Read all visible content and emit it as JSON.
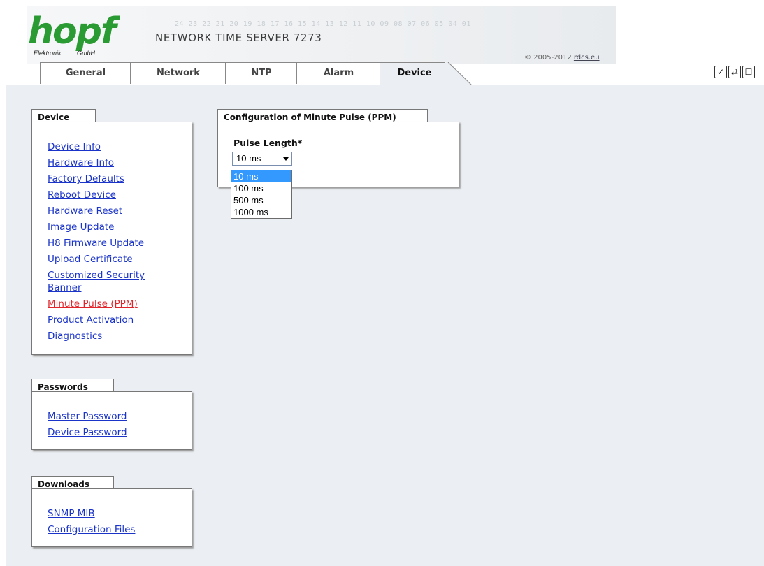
{
  "header": {
    "banner_digits": "24 23 22 21 20 19 18 17 16 15 14 13 12 11 10 09 08 07 06 05 04 01",
    "logo_text": "hopf",
    "logo_sub_left": "Elektronik",
    "logo_sub_right": "GmbH",
    "product_title": "NETWORK TIME SERVER 7273",
    "copyright_prefix": "© 2005-2012",
    "copyright_link": "rdcs.eu"
  },
  "tabs": [
    {
      "label": "General"
    },
    {
      "label": "Network"
    },
    {
      "label": "NTP"
    },
    {
      "label": "Alarm"
    },
    {
      "label": "Device"
    }
  ],
  "active_tab": "Device",
  "toolbar_icons": [
    "apply-check-icon",
    "reload-icon",
    "page-icon"
  ],
  "toolbar_glyphs": {
    "apply": "✓",
    "reload": "⇄",
    "page": "☐"
  },
  "sidebar": {
    "device": {
      "title": "Device",
      "items": [
        {
          "label": "Device Info"
        },
        {
          "label": "Hardware Info"
        },
        {
          "label": "Factory Defaults"
        },
        {
          "label": "Reboot Device"
        },
        {
          "label": "Hardware Reset"
        },
        {
          "label": "Image Update"
        },
        {
          "label": "H8 Firmware Update"
        },
        {
          "label": "Upload Certificate"
        },
        {
          "label": "Customized Security Banner"
        },
        {
          "label": "Minute Pulse (PPM)"
        },
        {
          "label": "Product Activation"
        },
        {
          "label": "Diagnostics"
        }
      ]
    },
    "passwords": {
      "title": "Passwords",
      "items": [
        {
          "label": "Master Password"
        },
        {
          "label": "Device Password"
        }
      ]
    },
    "downloads": {
      "title": "Downloads",
      "items": [
        {
          "label": "SNMP MIB"
        },
        {
          "label": "Configuration Files"
        }
      ]
    }
  },
  "ppm_config": {
    "title": "Configuration of Minute Pulse (PPM)",
    "pulse_length_label": "Pulse Length*",
    "selected_value": "10 ms",
    "options": [
      "10 ms",
      "100 ms",
      "500 ms",
      "1000 ms"
    ]
  },
  "colors": {
    "link": "#1a33c8",
    "active_link": "#e0242a",
    "logo_green": "#2a9a33",
    "content_bg": "#ebeef2",
    "dropdown_highlight": "#3399ff"
  }
}
